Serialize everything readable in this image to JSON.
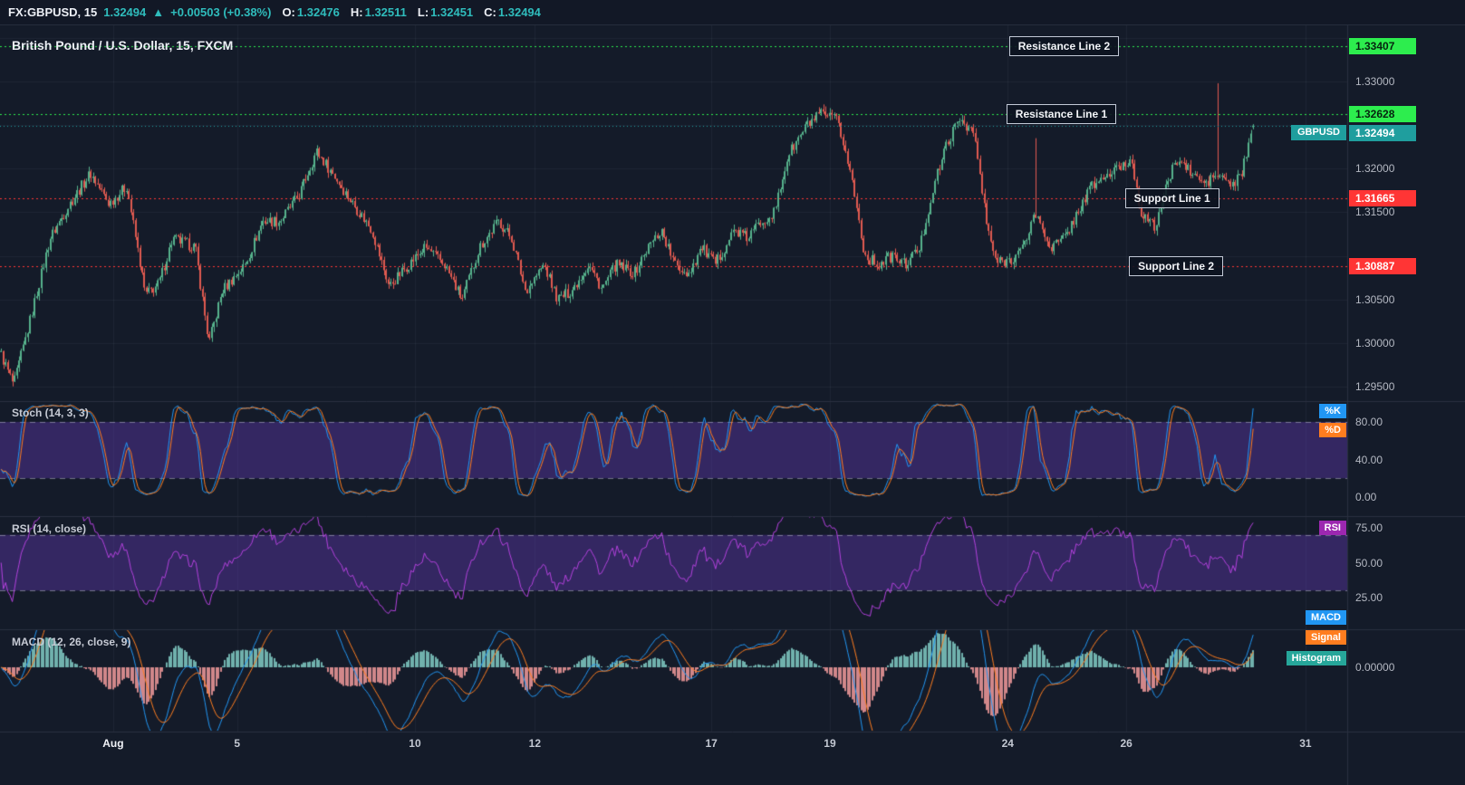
{
  "colors": {
    "bg": "#141b29",
    "panel_border": "#2a3040",
    "grid": "rgba(151,166,197,0.08)",
    "accent_teal": "#2fbcbc",
    "teal_tag": "#1f9e9e",
    "up": "#56b28c",
    "down": "#e05a50",
    "resistance": "#2ded4e",
    "support": "#ff3535",
    "k_blue": "#2196f3",
    "d_orange": "#ff7d1f",
    "rsi_purple": "#b341dd",
    "rsi_tag": "#9c27b0",
    "hist_teal": "#26a69a",
    "hist_pos": "rgba(128,203,196,0.85)",
    "hist_neg": "rgba(242,154,155,0.85)",
    "band_fill": "rgba(98,57,178,0.42)",
    "dashed": "#b6bcc9"
  },
  "topbar": {
    "symbol": "FX:GBPUSD, 15",
    "last_price": "1.32494",
    "arrow": "▲",
    "change": "+0.00503 (+0.38%)",
    "ohlc": [
      {
        "label": "O:",
        "value": "1.32476"
      },
      {
        "label": "H:",
        "value": "1.32511"
      },
      {
        "label": "L:",
        "value": "1.32451"
      },
      {
        "label": "C:",
        "value": "1.32494"
      }
    ]
  },
  "chart_data": [
    {
      "type": "candlestick",
      "title": "British Pound / U.S. Dollar, 15, FXCM",
      "symbol_tag": "GBPUSD",
      "last_ohlc": {
        "open": 1.32476,
        "high": 1.32511,
        "low": 1.32451,
        "close": 1.32494
      },
      "current_price": 1.32494,
      "current_price_label": "1.32494",
      "change_label": "+0.00503 (+0.38%)",
      "ylim": [
        1.2934,
        1.3364
      ],
      "y_ticks": [
        "1.33000",
        "1.32000",
        "1.31500",
        "1.30500",
        "1.30000",
        "1.29500"
      ],
      "x_ticks": [
        "Aug",
        "5",
        "10",
        "12",
        "17",
        "19",
        "24",
        "26",
        "31"
      ],
      "x_tick_frac": [
        0.084,
        0.176,
        0.308,
        0.397,
        0.528,
        0.616,
        0.748,
        0.836,
        0.969
      ],
      "levels": [
        {
          "label": "Resistance Line 2",
          "price": 1.33407,
          "price_label": "1.33407",
          "kind": "resistance",
          "label_x": 0.749
        },
        {
          "label": "Resistance Line 1",
          "price": 1.32628,
          "price_label": "1.32628",
          "kind": "resistance",
          "label_x": 0.747
        },
        {
          "label": "Support Line 1",
          "price": 1.31665,
          "price_label": "1.31665",
          "kind": "support",
          "label_x": 0.835
        },
        {
          "label": "Support Line 2",
          "price": 1.30887,
          "price_label": "1.30887",
          "kind": "support",
          "label_x": 0.838
        }
      ],
      "candle_count": 560,
      "data_end_frac": 0.931,
      "price_path": [
        [
          0,
          1.299
        ],
        [
          0.01,
          1.2952
        ],
        [
          0.02,
          1.301
        ],
        [
          0.037,
          1.312
        ],
        [
          0.05,
          1.3155
        ],
        [
          0.067,
          1.3195
        ],
        [
          0.081,
          1.316
        ],
        [
          0.094,
          1.318
        ],
        [
          0.108,
          1.3055
        ],
        [
          0.118,
          1.3068
        ],
        [
          0.128,
          1.312
        ],
        [
          0.145,
          1.311
        ],
        [
          0.155,
          1.3
        ],
        [
          0.165,
          1.306
        ],
        [
          0.182,
          1.309
        ],
        [
          0.195,
          1.314
        ],
        [
          0.208,
          1.314
        ],
        [
          0.222,
          1.317
        ],
        [
          0.235,
          1.322
        ],
        [
          0.249,
          1.319
        ],
        [
          0.262,
          1.316
        ],
        [
          0.276,
          1.313
        ],
        [
          0.289,
          1.3065
        ],
        [
          0.303,
          1.309
        ],
        [
          0.316,
          1.311
        ],
        [
          0.33,
          1.309
        ],
        [
          0.343,
          1.305
        ],
        [
          0.356,
          1.311
        ],
        [
          0.37,
          1.314
        ],
        [
          0.38,
          1.312
        ],
        [
          0.39,
          1.306
        ],
        [
          0.404,
          1.309
        ],
        [
          0.414,
          1.305
        ],
        [
          0.424,
          1.306
        ],
        [
          0.437,
          1.309
        ],
        [
          0.447,
          1.3062
        ],
        [
          0.457,
          1.309
        ],
        [
          0.471,
          1.308
        ],
        [
          0.481,
          1.311
        ],
        [
          0.491,
          1.313
        ],
        [
          0.501,
          1.309
        ],
        [
          0.511,
          1.308
        ],
        [
          0.521,
          1.311
        ],
        [
          0.531,
          1.309
        ],
        [
          0.545,
          1.313
        ],
        [
          0.555,
          1.312
        ],
        [
          0.565,
          1.314
        ],
        [
          0.575,
          1.315
        ],
        [
          0.585,
          1.3215
        ],
        [
          0.599,
          1.325
        ],
        [
          0.609,
          1.3262
        ],
        [
          0.622,
          1.3255
        ],
        [
          0.632,
          1.319
        ],
        [
          0.642,
          1.31
        ],
        [
          0.652,
          1.309
        ],
        [
          0.662,
          1.31
        ],
        [
          0.672,
          1.309
        ],
        [
          0.683,
          1.311
        ],
        [
          0.693,
          1.318
        ],
        [
          0.703,
          1.323
        ],
        [
          0.713,
          1.3258
        ],
        [
          0.723,
          1.324
        ],
        [
          0.733,
          1.313
        ],
        [
          0.74,
          1.3092
        ],
        [
          0.75,
          1.3096
        ],
        [
          0.76,
          1.311
        ],
        [
          0.768,
          1.315
        ],
        [
          0.78,
          1.311
        ],
        [
          0.79,
          1.312
        ],
        [
          0.8,
          1.315
        ],
        [
          0.81,
          1.318
        ],
        [
          0.82,
          1.319
        ],
        [
          0.83,
          1.32
        ],
        [
          0.84,
          1.321
        ],
        [
          0.847,
          1.315
        ],
        [
          0.857,
          1.3132
        ],
        [
          0.868,
          1.319
        ],
        [
          0.874,
          1.3212
        ],
        [
          0.881,
          1.32
        ],
        [
          0.888,
          1.319
        ],
        [
          0.895,
          1.3182
        ],
        [
          0.901,
          1.3192
        ],
        [
          0.908,
          1.319
        ],
        [
          0.915,
          1.318
        ],
        [
          0.921,
          1.3192
        ],
        [
          0.931,
          1.3249
        ]
      ],
      "wick_spikes": [
        {
          "x": 0.902,
          "high": 1.3298
        },
        {
          "x": 0.768,
          "high": 1.3235
        }
      ]
    },
    {
      "type": "line",
      "title": "Stoch (14, 3, 3)",
      "params": [
        14,
        3,
        3
      ],
      "series": [
        {
          "name": "%K",
          "color_key": "k_blue"
        },
        {
          "name": "%D",
          "color_key": "d_orange"
        }
      ],
      "ylim": [
        -20,
        102
      ],
      "y_ticks": [
        "80.00",
        "40.00",
        "0.00"
      ],
      "y_tick_vals": [
        80,
        40,
        0
      ],
      "bands": [
        20,
        80
      ]
    },
    {
      "type": "line",
      "title": "RSI (14, close)",
      "params": [
        14
      ],
      "series": [
        {
          "name": "RSI",
          "color_key": "rsi_purple"
        }
      ],
      "ylim": [
        2,
        83
      ],
      "y_ticks": [
        "75.00",
        "50.00",
        "25.00"
      ],
      "y_tick_vals": [
        75,
        50,
        25
      ],
      "bands": [
        30,
        70
      ]
    },
    {
      "type": "line+histogram",
      "title": "MACD (12, 26, close, 9)",
      "params": [
        12,
        26,
        9
      ],
      "series": [
        {
          "name": "MACD",
          "color_key": "k_blue"
        },
        {
          "name": "Signal",
          "color_key": "d_orange"
        },
        {
          "name": "Histogram",
          "color_key": "hist_teal"
        }
      ],
      "y_ticks": [
        "0.00000"
      ],
      "y_tick_vals": [
        0
      ]
    }
  ]
}
